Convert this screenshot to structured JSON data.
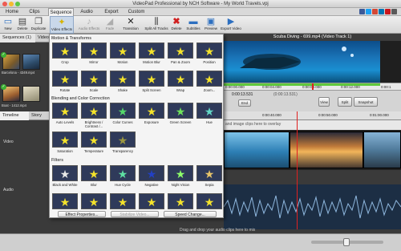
{
  "window": {
    "title": "VideoPad Professional by NCH Software - My World Travels.vpj"
  },
  "menu": {
    "tabs": [
      "Home",
      "Clips",
      "Sequence",
      "Audio",
      "Export",
      "Custom"
    ],
    "active": "Sequence"
  },
  "toolbar": {
    "buttons": [
      "New",
      "Delete",
      "Duplicate",
      "Video Effects",
      "Audio Effects",
      "Fade",
      "Transition",
      "Split All Tracks",
      "Delete",
      "Subtitles",
      "Preview",
      "Export Video"
    ]
  },
  "media": {
    "tabs": [
      "Sequences (1)",
      "Video"
    ],
    "items": [
      "Barcelona - 4349.mp4",
      "Boat - 1412.mp4"
    ]
  },
  "effects": {
    "sections": [
      "Motion & Transforms",
      "Blending and Color Correction",
      "Filters"
    ],
    "motion": [
      "Crop",
      "Mirror",
      "Motion",
      "Motion Blur",
      "Pan & Zoom",
      "Position",
      "Rotate",
      "Scale",
      "Shake",
      "Split Screen",
      "Wrap",
      "Zoom..."
    ],
    "blending": [
      "Auto Levels",
      "Brightness / Contrast /...",
      "Color Curves",
      "Exposure",
      "Green Screen",
      "Hue",
      "Saturation",
      "Temperature",
      "Transparency"
    ],
    "filters": [
      "Black and White",
      "Blur",
      "Hue Cycle",
      "Negative",
      "Night Vision",
      "Sepia"
    ],
    "buttons": {
      "properties": "Effect Properties...",
      "stabilize": "Stabilize Video...",
      "speed": "Speed Change..."
    }
  },
  "preview": {
    "title": "Scuba Diving - 699.mp4 (Video Track 1)",
    "ruler": [
      "0:00:00.000",
      "0:00:04.000",
      "0:00:08.000",
      "0:00:12.000",
      "0:00:1"
    ],
    "timecode": "0:00:13.531",
    "duration": "(0:00:13.531)",
    "end_label": "End",
    "view_label": "View",
    "split_label": "Split",
    "snapshot_label": "Snapshot"
  },
  "timeline": {
    "tabs": [
      "Timeline",
      "Story"
    ],
    "ruler": [
      "0:00:40.000",
      "0:00:50.000",
      "0:01:00.000"
    ],
    "overlay_hint": "and image clips here to overlay",
    "track_label": "Video",
    "audio_label": "Audio",
    "audio_hint": "Drag and drop your audio clips here to mix"
  },
  "colors": {
    "accent_green": "#3cb034",
    "progress_green": "#5fc83d",
    "playhead_red": "#e02020",
    "star_yellow": "#f3e22b"
  }
}
